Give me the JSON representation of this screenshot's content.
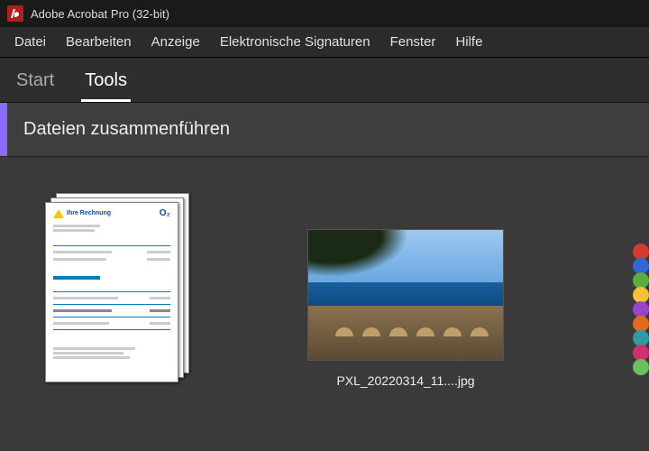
{
  "app": {
    "title": "Adobe Acrobat Pro (32-bit)"
  },
  "menu": {
    "file": "Datei",
    "edit": "Bearbeiten",
    "view": "Anzeige",
    "esign": "Elektronische Signaturen",
    "window": "Fenster",
    "help": "Hilfe"
  },
  "tabs": {
    "start": "Start",
    "tools": "Tools"
  },
  "panel": {
    "title": "Dateien zusammenführen"
  },
  "files": [
    {
      "filename_truncated": "",
      "doc_title": "Ihre Rechnung",
      "brand": "O₂"
    },
    {
      "filename": "PXL_20220314_11....jpg"
    }
  ]
}
